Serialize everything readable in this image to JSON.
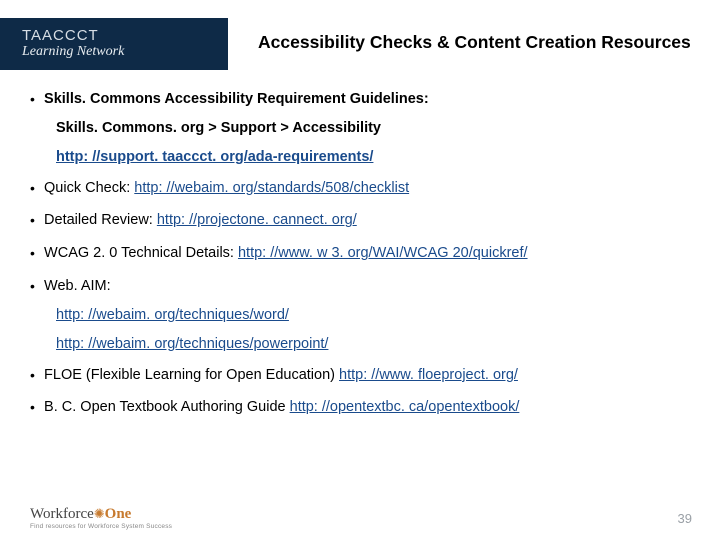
{
  "header": {
    "logo_top": "TAACCCT",
    "logo_bottom": "Learning Network",
    "title": "Accessibility Checks & Content Creation Resources"
  },
  "bullets": {
    "b1_label": "Skills. Commons Accessibility Requirement Guidelines:",
    "b1_sub1": "Skills. Commons. org > Support > Accessibility",
    "b1_sub2": "http: //support. taaccct. org/ada-requirements/",
    "b2_label": "Quick Check: ",
    "b2_link": "http: //webaim. org/standards/508/checklist",
    "b3_label": "Detailed Review: ",
    "b3_link": "http: //projectone. cannect. org/",
    "b4_label": "WCAG 2. 0 Technical Details: ",
    "b4_link": "http: //www. w 3. org/WAI/WCAG 20/quickref/",
    "b5_label": "Web. AIM:",
    "b5_sub1": "http: //webaim. org/techniques/word/",
    "b5_sub2": "http: //webaim. org/techniques/powerpoint/",
    "b6_label": "FLOE (Flexible Learning for Open Education) ",
    "b6_link": "http: //www. floeproject. org/",
    "b7_label": "B. C. Open Textbook Authoring Guide ",
    "b7_link": "http: //opentextbc. ca/opentextbook/"
  },
  "footer": {
    "brand_a": "Workforce",
    "brand_gear": "✺",
    "brand_b": "One",
    "tagline": "Find resources for Workforce System Success",
    "page": "39"
  }
}
